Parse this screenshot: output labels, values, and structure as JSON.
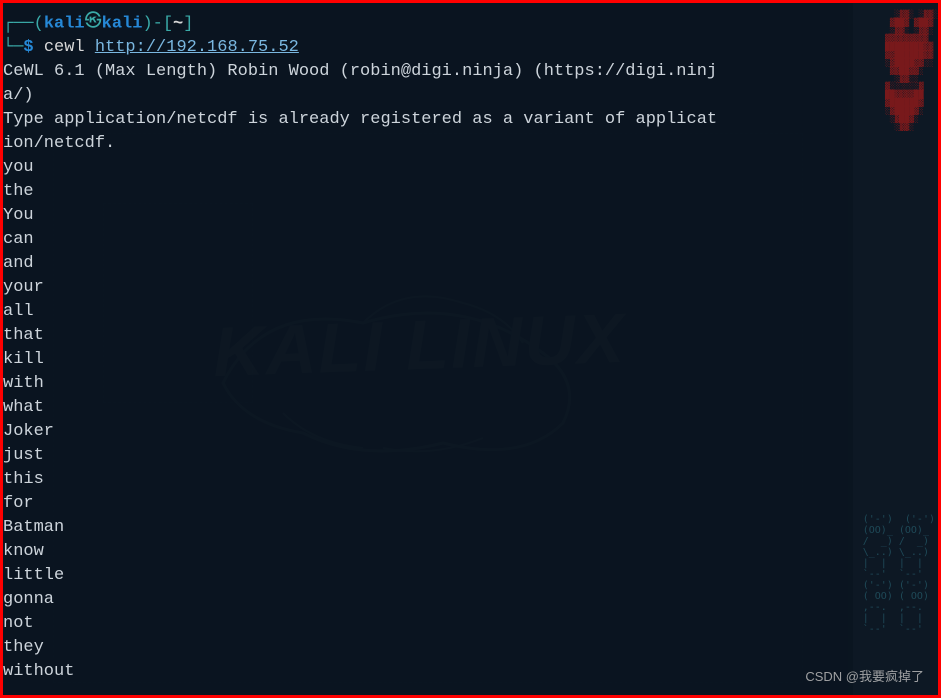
{
  "prompt": {
    "user": "kali",
    "host": "kali",
    "path": "~",
    "symbol": "$",
    "command": "cewl",
    "argument": "http://192.168.75.52"
  },
  "output": {
    "banner_line1": "CeWL 6.1 (Max Length) Robin Wood (robin@digi.ninja) (https://digi.ninj",
    "banner_line2": "a/)",
    "notice_line1": "Type application/netcdf is already registered as a variant of applicat",
    "notice_line2": "ion/netcdf."
  },
  "words": [
    "you",
    "the",
    "You",
    "can",
    "and",
    "your",
    "all",
    "that",
    "kill",
    "with",
    "what",
    "Joker",
    "just",
    "this",
    "for",
    "Batman",
    "know",
    "little",
    "gonna",
    "not",
    "they",
    "without"
  ],
  "watermark": {
    "site": "CSDN",
    "handle": "@我要疯掉了"
  },
  "bg_logo_text": "KALI LINUX"
}
